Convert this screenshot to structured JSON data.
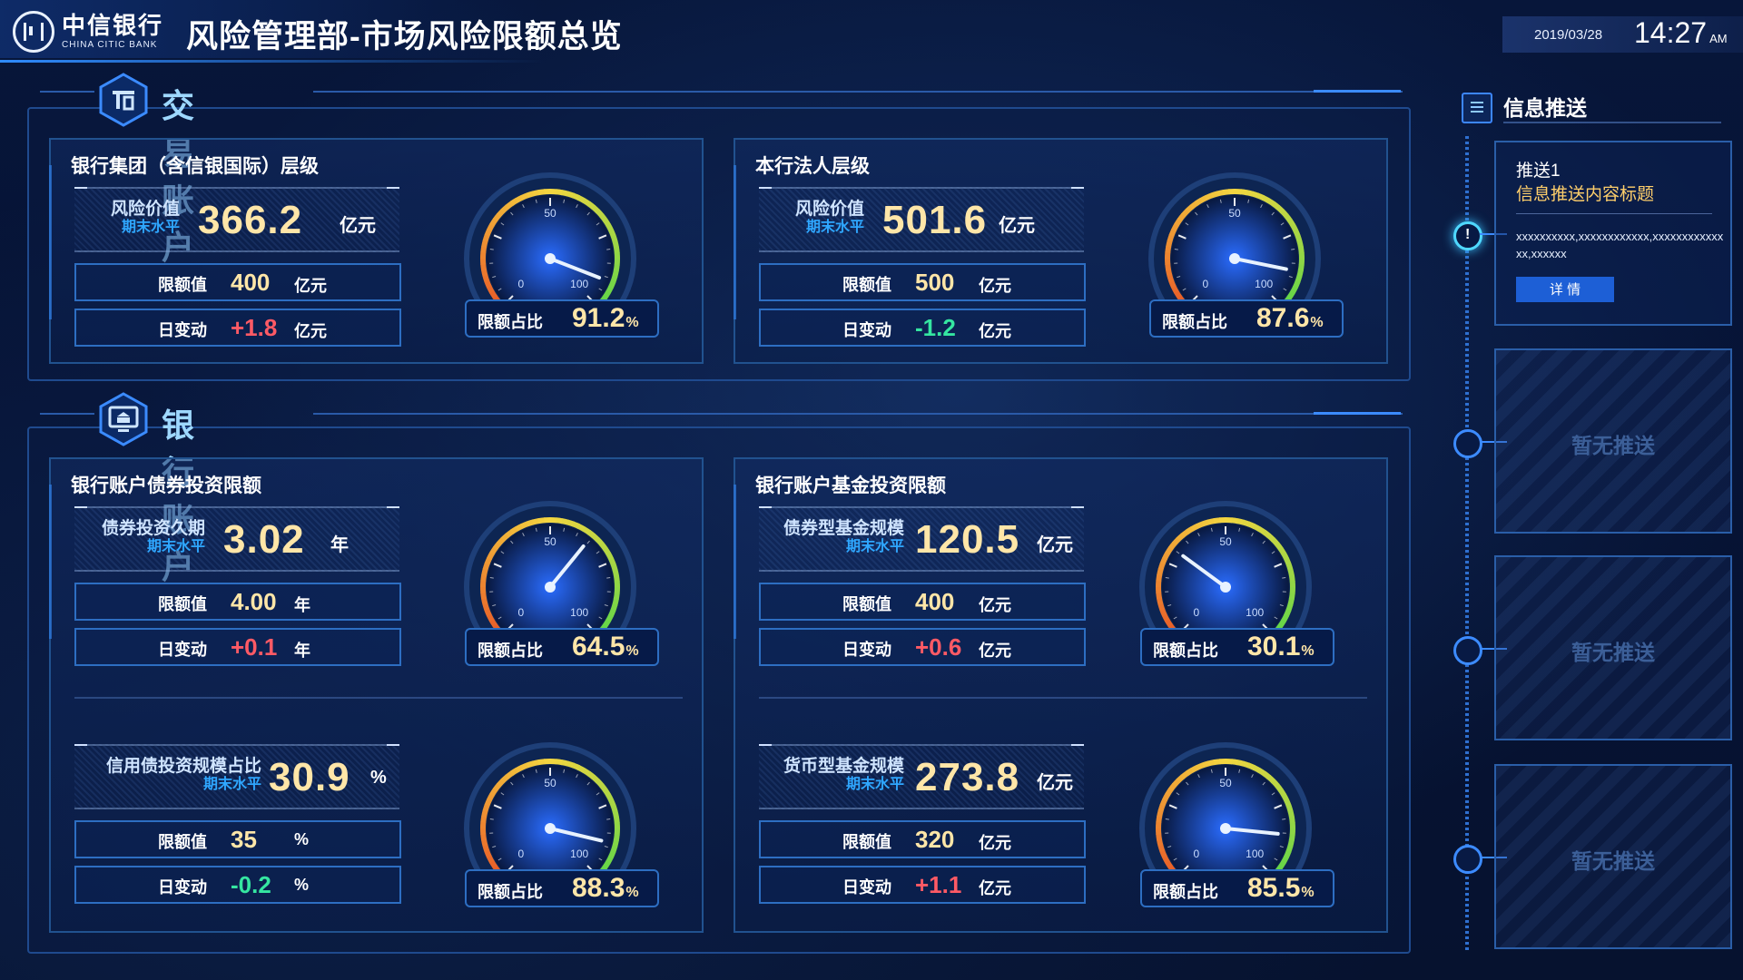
{
  "header": {
    "logo_cn": "中信银行",
    "logo_en": "CHINA CITIC BANK",
    "title": "风险管理部-市场风险限额总览",
    "date": "2019/03/28",
    "time": "14:27",
    "ampm": "AM"
  },
  "sections": {
    "trading": {
      "title": "交易账户"
    },
    "banking": {
      "title": "银行账户"
    }
  },
  "panels": {
    "group": {
      "title": "银行集团（含信银国际）层级",
      "kpi": {
        "name": "风险价值",
        "sub": "期末水平",
        "value": "366.2",
        "unit": "亿元"
      },
      "limit": {
        "label": "限额值",
        "value": "400",
        "unit": "亿元"
      },
      "change": {
        "label": "日变动",
        "value": "+1.8",
        "unit": "亿元"
      },
      "gauge": {
        "label": "限额占比",
        "value": "91.2",
        "pct": "%",
        "percent": 91.2,
        "min": "0",
        "mid": "50",
        "max": "100"
      }
    },
    "legal": {
      "title": "本行法人层级",
      "kpi": {
        "name": "风险价值",
        "sub": "期末水平",
        "value": "501.6",
        "unit": "亿元"
      },
      "limit": {
        "label": "限额值",
        "value": "500",
        "unit": "亿元"
      },
      "change": {
        "label": "日变动",
        "value": "-1.2",
        "unit": "亿元"
      },
      "gauge": {
        "label": "限额占比",
        "value": "87.6",
        "pct": "%",
        "percent": 87.6,
        "min": "0",
        "mid": "50",
        "max": "100"
      }
    },
    "bond": {
      "title": "银行账户债券投资限额",
      "items": [
        {
          "kpi": {
            "name": "债券投资久期",
            "sub": "期末水平",
            "value": "3.02",
            "unit": "年"
          },
          "limit": {
            "label": "限额值",
            "value": "4.00",
            "unit": "年"
          },
          "change": {
            "label": "日变动",
            "value": "+0.1",
            "unit": "年"
          },
          "gauge": {
            "label": "限额占比",
            "value": "64.5",
            "pct": "%",
            "percent": 64.5,
            "min": "0",
            "mid": "50",
            "max": "100"
          }
        },
        {
          "kpi": {
            "name": "信用债投资规模占比",
            "sub": "期末水平",
            "value": "30.9",
            "unit": "%"
          },
          "limit": {
            "label": "限额值",
            "value": "35",
            "unit": "%"
          },
          "change": {
            "label": "日变动",
            "value": "-0.2",
            "unit": "%"
          },
          "gauge": {
            "label": "限额占比",
            "value": "88.3",
            "pct": "%",
            "percent": 88.3,
            "min": "0",
            "mid": "50",
            "max": "100"
          }
        }
      ]
    },
    "fund": {
      "title": "银行账户基金投资限额",
      "items": [
        {
          "kpi": {
            "name": "债券型基金规模",
            "sub": "期末水平",
            "value": "120.5",
            "unit": "亿元"
          },
          "limit": {
            "label": "限额值",
            "value": "400",
            "unit": "亿元"
          },
          "change": {
            "label": "日变动",
            "value": "+0.6",
            "unit": "亿元"
          },
          "gauge": {
            "label": "限额占比",
            "value": "30.1",
            "pct": "%",
            "percent": 30.1,
            "min": "0",
            "mid": "50",
            "max": "100"
          }
        },
        {
          "kpi": {
            "name": "货币型基金规模",
            "sub": "期末水平",
            "value": "273.8",
            "unit": "亿元"
          },
          "limit": {
            "label": "限额值",
            "value": "320",
            "unit": "亿元"
          },
          "change": {
            "label": "日变动",
            "value": "+1.1",
            "unit": "亿元"
          },
          "gauge": {
            "label": "限额占比",
            "value": "85.5",
            "pct": "%",
            "percent": 85.5,
            "min": "0",
            "mid": "50",
            "max": "100"
          }
        }
      ]
    }
  },
  "info": {
    "title": "信息推送",
    "push": {
      "no": "推送1",
      "title": "信息推送内容标题",
      "body": "xxxxxxxxxx,xxxxxxxxxxxx,xxxxxxxxxxxxxx,xxxxxx",
      "button": "详 情"
    },
    "empty": [
      "暂无推送",
      "暂无推送",
      "暂无推送"
    ]
  },
  "colors": {
    "accent": "#3b8bff",
    "value_yellow": "#ffe6a8",
    "up_red": "#ff5a65",
    "down_green": "#35e6a1",
    "background": "#061335"
  }
}
